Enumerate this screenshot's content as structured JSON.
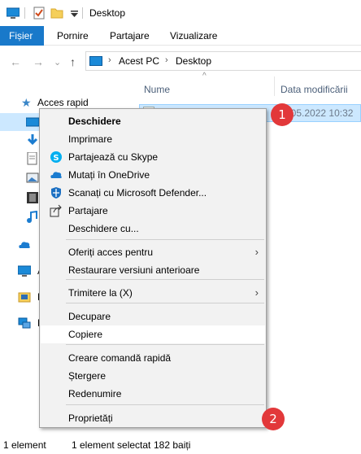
{
  "window": {
    "title": "Desktop"
  },
  "ribbon": {
    "tabs": [
      "Fișier",
      "Pornire",
      "Partajare",
      "Vizualizare"
    ]
  },
  "address": {
    "crumbs": [
      "Acest PC",
      "Desktop"
    ]
  },
  "nav": {
    "quick_access": "Acces rapid",
    "fragments": [
      "A",
      "E",
      "R"
    ]
  },
  "columns": {
    "name": "Nume",
    "date": "Data modificării"
  },
  "file": {
    "date": "17.05.2022 10:32"
  },
  "badges": [
    "1",
    "2"
  ],
  "status": {
    "count": "1 element",
    "selected": "1 element selectat",
    "size": "182 baiți"
  },
  "context_menu": {
    "items": [
      {
        "label": "Deschidere",
        "icon": "",
        "bold": true
      },
      {
        "label": "Imprimare",
        "icon": ""
      },
      {
        "label": "Partajează cu Skype",
        "icon": "skype-icon"
      },
      {
        "label": "Mutați în OneDrive",
        "icon": "onedrive-icon"
      },
      {
        "label": "Scanați cu Microsoft Defender...",
        "icon": "defender-icon"
      },
      {
        "label": "Partajare",
        "icon": "share-icon"
      },
      {
        "label": "Deschidere cu...",
        "icon": ""
      },
      {
        "label": "Oferiți acces pentru",
        "icon": "",
        "submenu": true
      },
      {
        "label": "Restaurare versiuni anterioare",
        "icon": ""
      },
      {
        "label": "Trimitere la (X)",
        "icon": "",
        "submenu": true
      },
      {
        "label": "Decupare",
        "icon": ""
      },
      {
        "label": "Copiere",
        "icon": "",
        "hover": true
      },
      {
        "label": "Creare comandă rapidă",
        "icon": ""
      },
      {
        "label": "Ștergere",
        "icon": ""
      },
      {
        "label": "Redenumire",
        "icon": ""
      },
      {
        "label": "Proprietăți",
        "icon": ""
      }
    ]
  },
  "colors": {
    "accent": "#1979ca",
    "selection": "#cce8ff",
    "badge": "#e2383a"
  }
}
